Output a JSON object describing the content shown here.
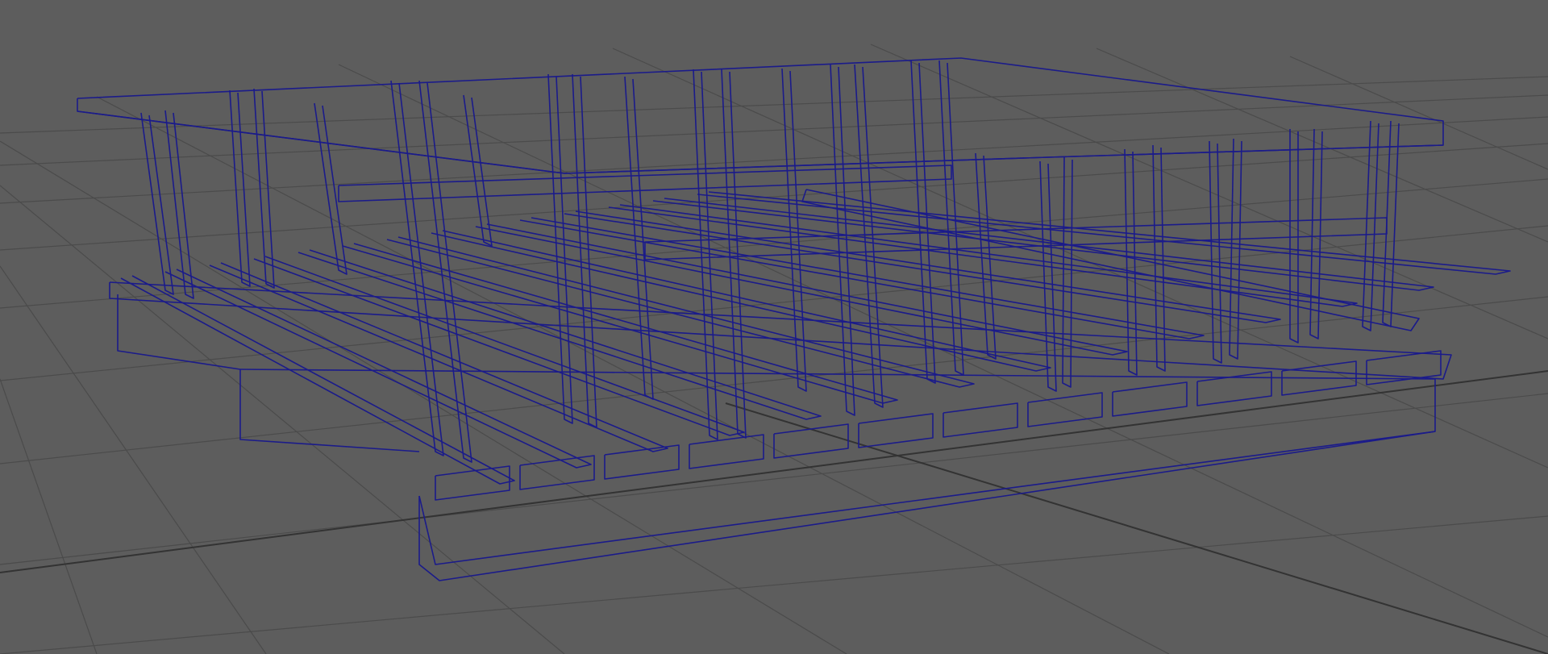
{
  "viewport": {
    "background_color": "#5d5d5d",
    "grid_color": "#4b4b4b",
    "axis_color": "#333333",
    "wireframe_color": "#1b1b8a",
    "display_mode": "wireframe",
    "grid_visible": true
  }
}
